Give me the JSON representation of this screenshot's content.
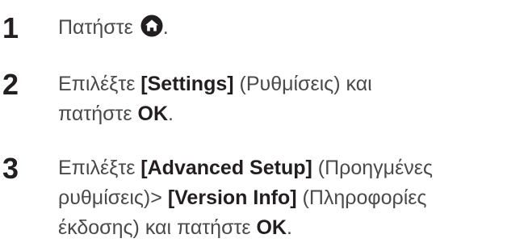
{
  "steps": [
    {
      "number": "1",
      "lines": [
        {
          "segments": [
            {
              "text": "Πατήστε ",
              "style": "light"
            }
          ],
          "icon": "home-icon",
          "after_icon": "."
        }
      ]
    },
    {
      "number": "2",
      "lines": [
        {
          "segments": [
            {
              "text": "Επιλέξτε ",
              "style": "light"
            },
            {
              "text": "[Settings]",
              "style": "bold"
            },
            {
              "text": " (Ρυθμίσεις) και",
              "style": "light"
            }
          ]
        },
        {
          "segments": [
            {
              "text": "πατήστε ",
              "style": "light"
            },
            {
              "text": "OK",
              "style": "bold"
            },
            {
              "text": ".",
              "style": "light"
            }
          ]
        }
      ]
    },
    {
      "number": "3",
      "lines": [
        {
          "segments": [
            {
              "text": "Επιλέξτε ",
              "style": "light"
            },
            {
              "text": "[Advanced Setup]",
              "style": "bold"
            },
            {
              "text": " (Προηγμένες",
              "style": "light"
            }
          ]
        },
        {
          "segments": [
            {
              "text": "ρυθμίσεις)> ",
              "style": "light"
            },
            {
              "text": "[Version Info]",
              "style": "bold"
            },
            {
              "text": " (Πληροφορίες",
              "style": "light"
            }
          ]
        },
        {
          "segments": [
            {
              "text": "έκδοσης) και πατήστε ",
              "style": "light"
            },
            {
              "text": "OK",
              "style": "bold"
            },
            {
              "text": ".",
              "style": "light"
            }
          ]
        }
      ]
    }
  ],
  "colors": {
    "text": "#231f20",
    "icon_fill": "#231f20",
    "icon_house": "#ffffff"
  }
}
